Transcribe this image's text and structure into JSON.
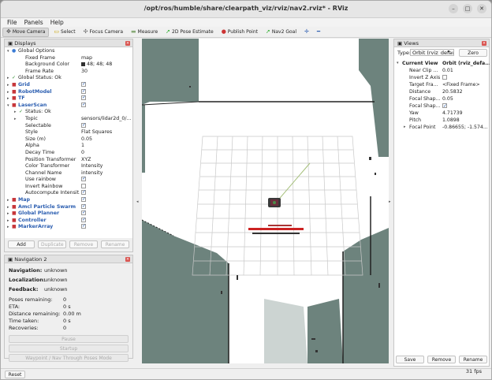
{
  "window": {
    "title": "/opt/ros/humble/share/clearpath_viz/rviz/nav2.rviz* - RViz"
  },
  "menu": {
    "file": "File",
    "panels": "Panels",
    "help": "Help"
  },
  "toolbar": {
    "move_camera": "Move Camera",
    "select": "Select",
    "focus_camera": "Focus Camera",
    "measure": "Measure",
    "pose_estimate": "2D Pose Estimate",
    "publish_point": "Publish Point",
    "nav2_goal": "Nav2 Goal"
  },
  "displays": {
    "header": "Displays",
    "rows": [
      {
        "label": "Global Options",
        "indent": 1,
        "arrow": "▾",
        "icon": "globe"
      },
      {
        "label": "Fixed Frame",
        "indent": 2,
        "value": "map"
      },
      {
        "label": "Background Color",
        "indent": 2,
        "value": "48; 48; 48",
        "swatch": true
      },
      {
        "label": "Frame Rate",
        "indent": 2,
        "value": "30"
      },
      {
        "label": "Global Status: Ok",
        "indent": 1,
        "arrow": "▸",
        "icon": "check"
      },
      {
        "label": "Grid",
        "indent": 1,
        "arrow": "▸",
        "blue": true,
        "check": true
      },
      {
        "label": "RobotModel",
        "indent": 1,
        "arrow": "▸",
        "blue": true,
        "check": true
      },
      {
        "label": "TF",
        "indent": 1,
        "arrow": "▸",
        "blue": true,
        "check": true
      },
      {
        "label": "LaserScan",
        "indent": 1,
        "arrow": "▾",
        "blue": true,
        "check": true
      },
      {
        "label": "Status: Ok",
        "indent": 2,
        "arrow": "▸",
        "icon": "check"
      },
      {
        "label": "Topic",
        "indent": 2,
        "arrow": "▸",
        "value": "sensors/lidar2d_0/..."
      },
      {
        "label": "Selectable",
        "indent": 2,
        "check": true
      },
      {
        "label": "Style",
        "indent": 2,
        "value": "Flat Squares"
      },
      {
        "label": "Size (m)",
        "indent": 2,
        "value": "0.05"
      },
      {
        "label": "Alpha",
        "indent": 2,
        "value": "1"
      },
      {
        "label": "Decay Time",
        "indent": 2,
        "value": "0"
      },
      {
        "label": "Position Transformer",
        "indent": 2,
        "value": "XYZ"
      },
      {
        "label": "Color Transformer",
        "indent": 2,
        "value": "Intensity"
      },
      {
        "label": "Channel Name",
        "indent": 2,
        "value": "intensity"
      },
      {
        "label": "Use rainbow",
        "indent": 2,
        "check": true
      },
      {
        "label": "Invert Rainbow",
        "indent": 2,
        "check": false
      },
      {
        "label": "Autocompute Intensit...",
        "indent": 2,
        "check": true
      },
      {
        "label": "Map",
        "indent": 1,
        "arrow": "▸",
        "blue": true,
        "check": true
      },
      {
        "label": "Amcl Particle Swarm",
        "indent": 1,
        "arrow": "▸",
        "blue": true,
        "check": true
      },
      {
        "label": "Global Planner",
        "indent": 1,
        "arrow": "▸",
        "blue": true,
        "check": true
      },
      {
        "label": "Controller",
        "indent": 1,
        "arrow": "▸",
        "blue": true,
        "check": true
      },
      {
        "label": "MarkerArray",
        "indent": 1,
        "arrow": "▸",
        "blue": true,
        "check": true
      }
    ],
    "buttons": {
      "add": "Add",
      "duplicate": "Duplicate",
      "remove": "Remove",
      "rename": "Rename"
    }
  },
  "navigation": {
    "header": "Navigation 2",
    "navigation_label": "Navigation:",
    "navigation_value": "unknown",
    "localization_label": "Localization:",
    "localization_value": "unknown",
    "feedback_label": "Feedback:",
    "feedback_value": "unknown",
    "stats": [
      {
        "label": "Poses remaining:",
        "value": "0"
      },
      {
        "label": "ETA:",
        "value": "0 s"
      },
      {
        "label": "Distance remaining:",
        "value": "0.00 m"
      },
      {
        "label": "Time taken:",
        "value": "0 s"
      },
      {
        "label": "Recoveries:",
        "value": "0"
      }
    ],
    "pause": "Pause",
    "startup": "Startup",
    "waypoint": "Waypoint / Nav Through Poses Mode"
  },
  "views": {
    "header": "Views",
    "type_label": "Type:",
    "type_value": "Orbit (rviz_defau",
    "zero": "Zero",
    "rows": [
      {
        "label": "Current View",
        "value": "Orbit (rviz_defa...",
        "bold": true,
        "arrow": "▾"
      },
      {
        "label": "Near Clip ...",
        "value": "0.01"
      },
      {
        "label": "Invert Z Axis",
        "check": false
      },
      {
        "label": "Target Fra...",
        "value": "<Fixed Frame>"
      },
      {
        "label": "Distance",
        "value": "20.5832"
      },
      {
        "label": "Focal Shap...",
        "value": "0.05"
      },
      {
        "label": "Focal Shap...",
        "check": true
      },
      {
        "label": "Yaw",
        "value": "4.71739"
      },
      {
        "label": "Pitch",
        "value": "1.0898"
      },
      {
        "label": "Focal Point",
        "value": "-0.86655; -1.574...",
        "arrow": "▸"
      }
    ],
    "save": "Save",
    "remove": "Remove",
    "rename": "Rename"
  },
  "status": {
    "reset": "Reset",
    "fps": "31 fps"
  },
  "colors": {
    "map_gray": "#6d837d",
    "background": "#303030",
    "accent": "#2a5db0"
  }
}
